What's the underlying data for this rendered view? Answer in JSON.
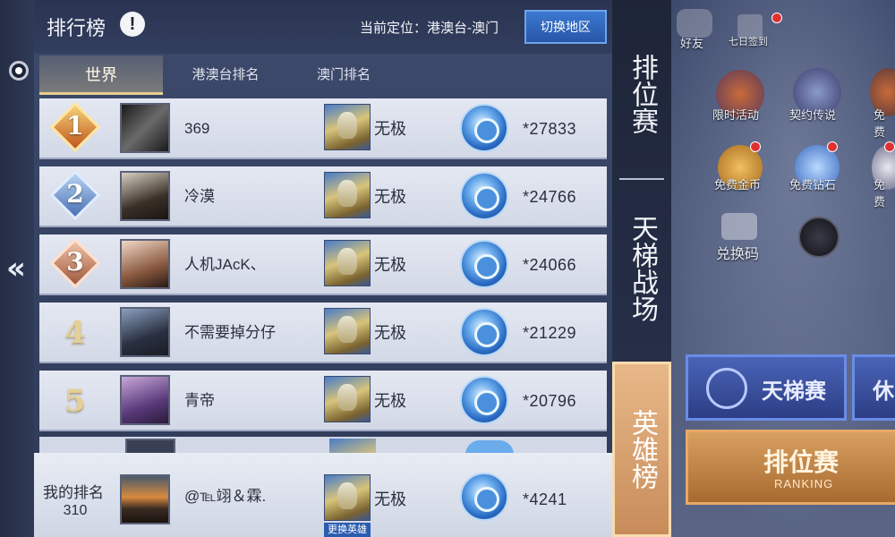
{
  "header": {
    "title": "排行榜",
    "info_icon": "!",
    "location_label": "当前定位：港澳台-澳门",
    "switch_button": "切换地区"
  },
  "tabs": [
    {
      "label": "世界",
      "active": true
    },
    {
      "label": "港澳台排名",
      "active": false
    },
    {
      "label": "澳门排名",
      "active": false
    }
  ],
  "rows": [
    {
      "rank": "1",
      "name": "369",
      "hero": "无极",
      "score": "*27833",
      "badge": "gold"
    },
    {
      "rank": "2",
      "name": "冷漠",
      "hero": "无极",
      "score": "*24766",
      "badge": "silver"
    },
    {
      "rank": "3",
      "name": "人机JAcK、",
      "hero": "无极",
      "score": "*24066",
      "badge": "bronze"
    },
    {
      "rank": "4",
      "name": "不需要掉分仔",
      "hero": "无极",
      "score": "*21229"
    },
    {
      "rank": "5",
      "name": "青帝",
      "hero": "无极",
      "score": "*20796"
    }
  ],
  "my_rank": {
    "label": "我的排名",
    "rank": "310",
    "name": "@℡翊＆霖.",
    "hero": "无极",
    "change_hero": "更换英雄",
    "score": "*4241"
  },
  "side_nav": {
    "rank_tab": "排位赛",
    "ladder_tab": "天梯战场",
    "hero_tab": "英雄榜"
  },
  "background_hud": {
    "friends": "好友",
    "checkin": "七日签到",
    "limited": "限时活动",
    "contract": "契约传说",
    "free": "免费",
    "free_gold": "免费金币",
    "free_diamond": "免费钻石",
    "free2": "免费",
    "redeem": "兑换码",
    "ladder_button": "天梯赛",
    "ladder_button2": "休",
    "ranking_button": "排位赛",
    "ranking_sub": "RANKING"
  },
  "colors": {
    "accent_blue": "#2f5fb0",
    "gold_tab": "#e8d08c",
    "hero_tab": "#d8a070"
  },
  "icons": {
    "back": "double-chevron-left-icon",
    "score": "blue-gem-medal-icon",
    "info": "exclamation-circle-icon"
  }
}
